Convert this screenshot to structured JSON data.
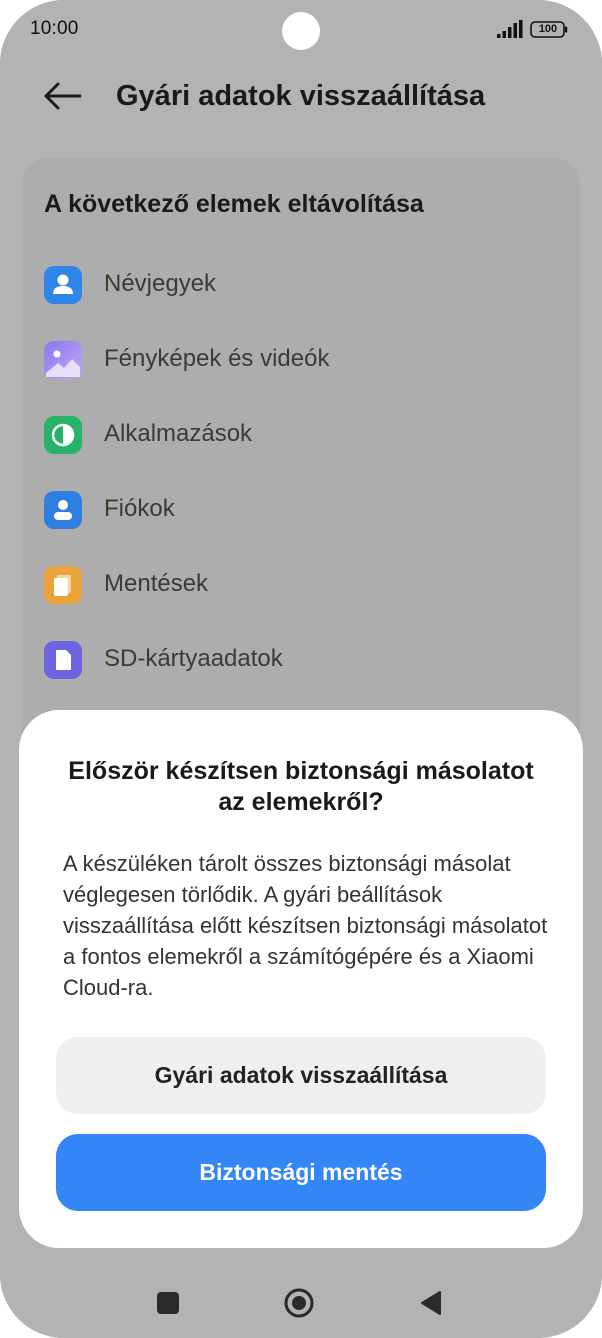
{
  "status_bar": {
    "time": "10:00",
    "battery": "100"
  },
  "header": {
    "title": "Gyári adatok visszaállítása",
    "back_icon": "arrow-left-icon"
  },
  "card": {
    "title": "A következő elemek eltávolítása",
    "items": [
      {
        "label": "Névjegyek",
        "icon": "contact-icon",
        "color": "#2f86e8"
      },
      {
        "label": "Fényképek és videók",
        "icon": "gallery-icon",
        "color": "#7b70e6"
      },
      {
        "label": "Alkalmazások",
        "icon": "pie-chart-icon",
        "color": "#27b46a"
      },
      {
        "label": "Fiókok",
        "icon": "account-icon",
        "color": "#2f7fe0"
      },
      {
        "label": "Mentések",
        "icon": "backup-files-icon",
        "color": "#e8a43a"
      },
      {
        "label": "SD-kártyaadatok",
        "icon": "sd-card-icon",
        "color": "#6e63e0"
      }
    ]
  },
  "dialog": {
    "title": "Először készítsen biztonsági másolatot az elemekről?",
    "body": "A készüléken tárolt összes biztonsági másolat véglegesen törlődik. A gyári beállítások visszaállítása előtt készítsen biztonsági másolatot a fontos elemekről a számítógépére és a Xiaomi Cloud-ra.",
    "secondary_button": "Gyári adatok visszaállítása",
    "primary_button": "Biztonsági mentés"
  },
  "colors": {
    "primary": "#3486f7",
    "scrim": "#b3b3b3"
  }
}
